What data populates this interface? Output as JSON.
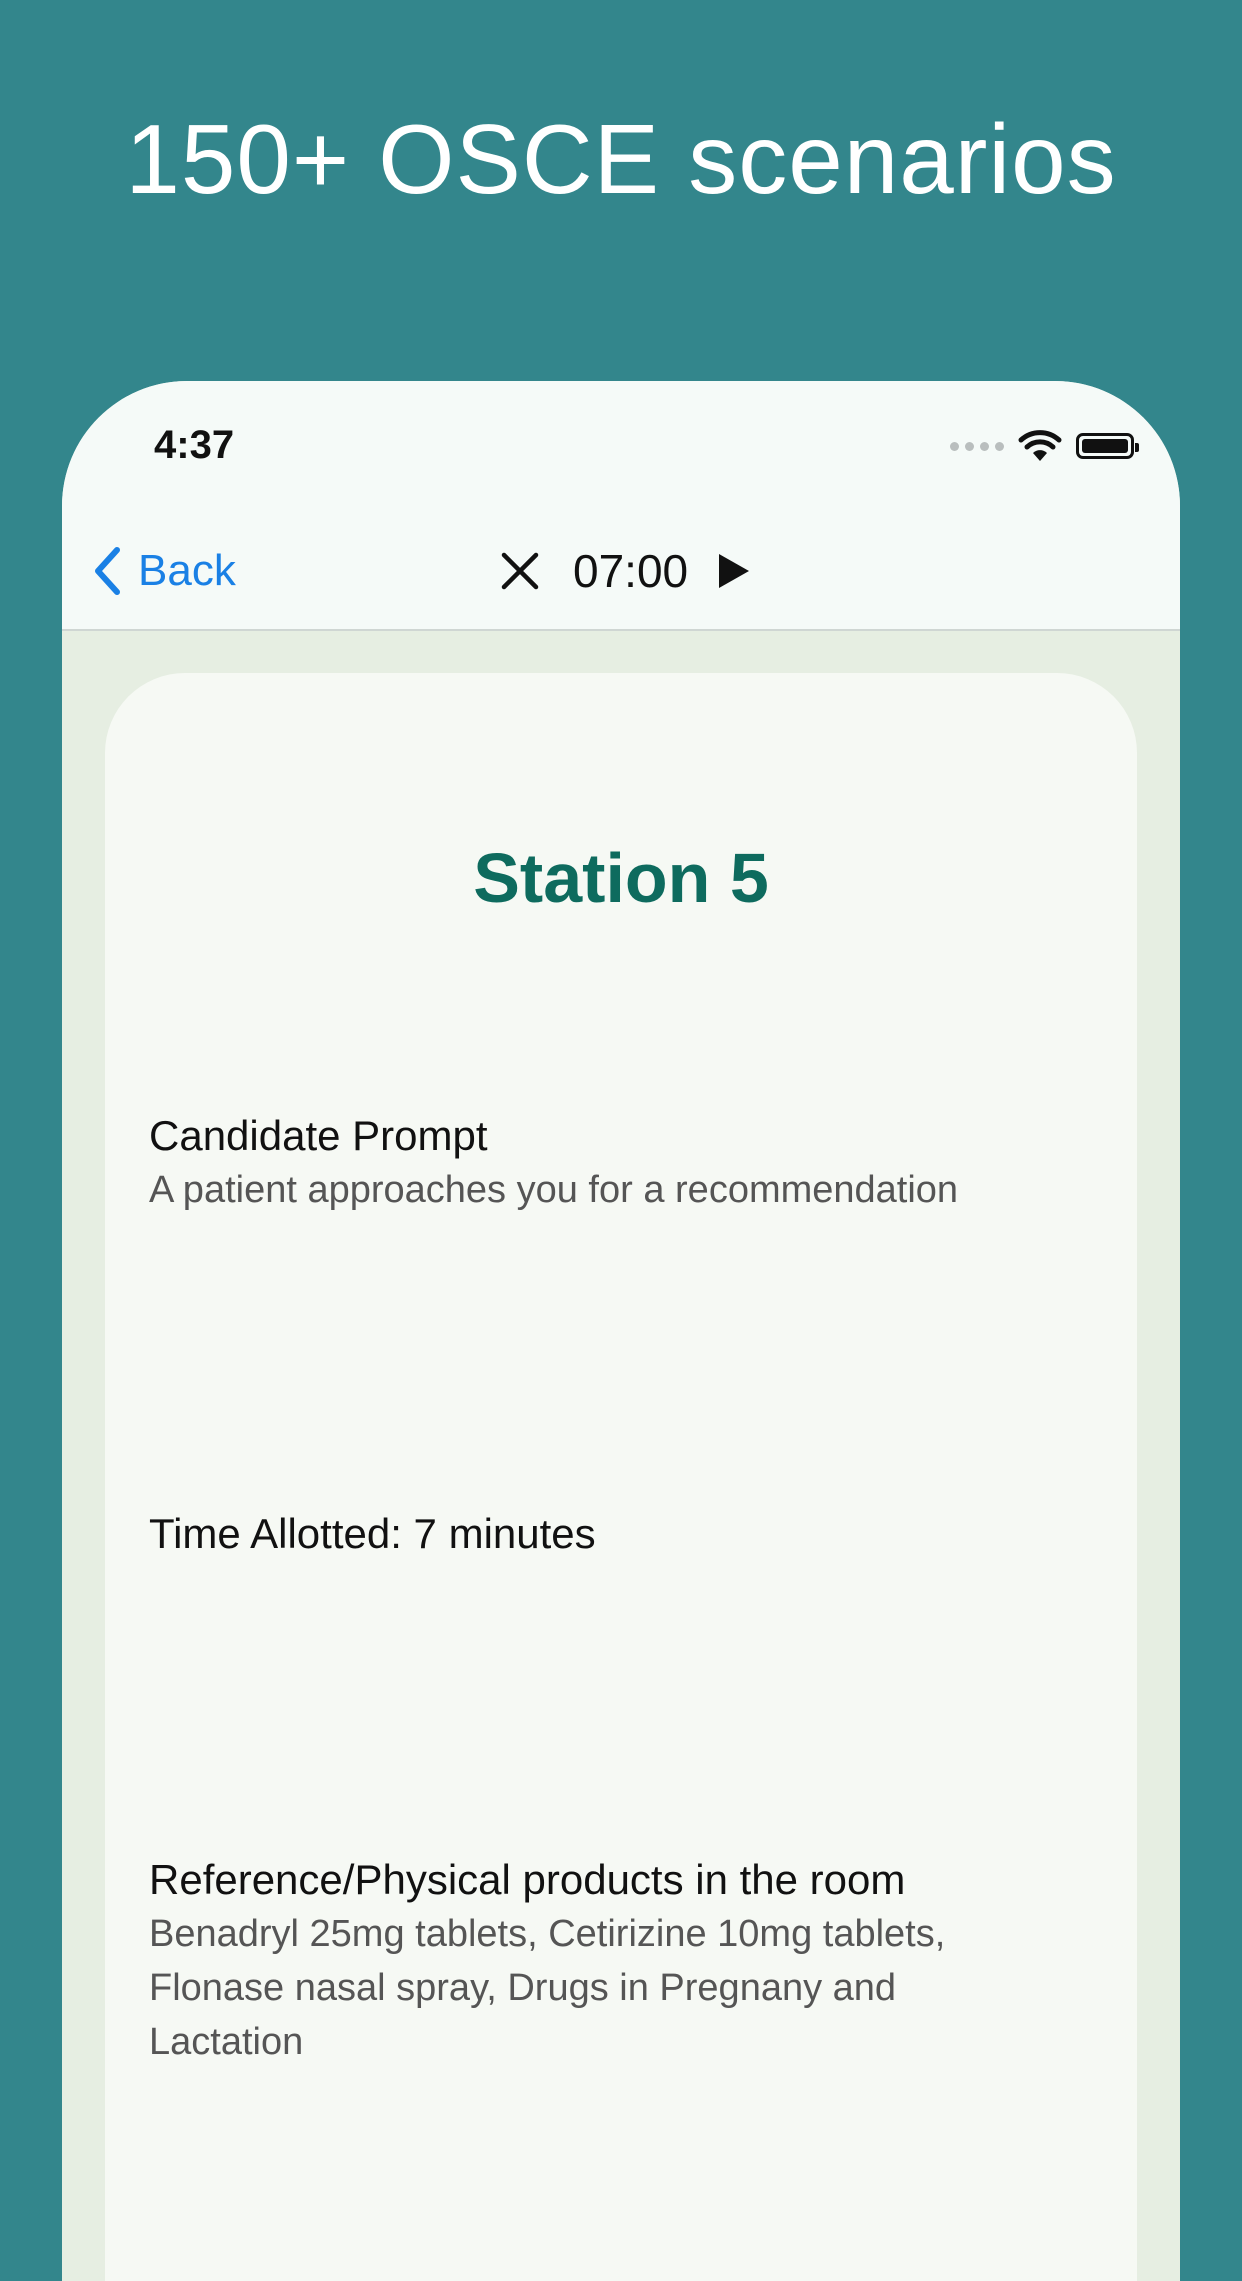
{
  "headline": "150+ OSCE scenarios",
  "status_bar": {
    "time": "4:37"
  },
  "nav": {
    "back_label": "Back",
    "timer": "07:00"
  },
  "station": {
    "title": "Station 5",
    "candidate_prompt": {
      "heading": "Candidate Prompt",
      "body": "A patient approaches you for a recommendation"
    },
    "time_allotted": "Time Allotted: 7 minutes",
    "references": {
      "heading": "Reference/Physical products in the room",
      "body": "Benadryl 25mg tablets, Cetirizine 10mg tablets, Flonase nasal spray, Drugs in Pregnany and Lactation"
    }
  },
  "colors": {
    "background": "#33868C",
    "title_green": "#0E6B5E",
    "link_blue": "#1A80E5",
    "card": "#F6F9F4",
    "frame": "#E6EEE2"
  },
  "icons": [
    "chevron-left-icon",
    "close-icon",
    "play-icon",
    "wifi-icon",
    "battery-icon",
    "signal-dots-icon"
  ]
}
